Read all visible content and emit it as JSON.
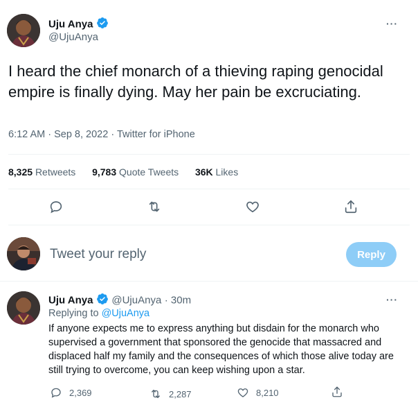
{
  "main_tweet": {
    "author_name": "Uju Anya",
    "author_handle": "@UjuAnya",
    "text": "I heard the chief monarch of a thieving raping genocidal empire is finally dying. May her pain be excruciating.",
    "time": "6:12 AM",
    "date": "Sep 8, 2022",
    "source": "Twitter for iPhone",
    "separator": " · ",
    "stats": {
      "retweets_count": "8,325",
      "retweets_label": "Retweets",
      "quotes_count": "9,783",
      "quotes_label": "Quote Tweets",
      "likes_count": "36K",
      "likes_label": "Likes"
    },
    "more_label": "···"
  },
  "reply_box": {
    "placeholder": "Tweet your reply",
    "button_label": "Reply"
  },
  "reply_tweet": {
    "author_name": "Uju Anya",
    "author_handle": "@UjuAnya",
    "time_ago": "· 30m",
    "replying_prefix": "Replying to",
    "replying_handle": "@UjuAnya",
    "text": "If anyone expects me to express anything but disdain for the monarch who supervised a government that sponsored the genocide that massacred and displaced half my family and the consequences of which those alive today are still trying to overcome, you can keep wishing upon a star.",
    "reply_count": "2,369",
    "retweet_count": "2,287",
    "like_count": "8,210",
    "more_label": "···"
  },
  "colors": {
    "verified": "#1d9bf0",
    "text": "#0f1419",
    "secondary": "#536471",
    "reply_button": "#8ecdf7"
  }
}
